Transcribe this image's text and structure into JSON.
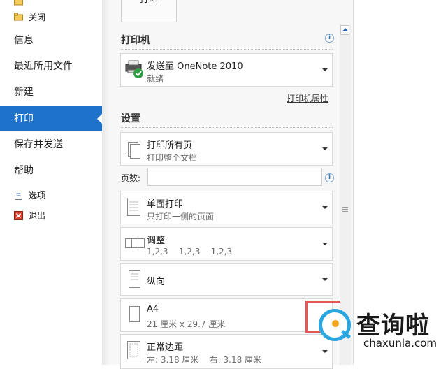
{
  "nav": {
    "close_label": "关闭",
    "items": [
      {
        "label": "信息",
        "active": false
      },
      {
        "label": "最近所用文件",
        "active": false
      },
      {
        "label": "新建",
        "active": false
      },
      {
        "label": "打印",
        "active": true
      },
      {
        "label": "保存并发送",
        "active": false
      },
      {
        "label": "帮助",
        "active": false
      }
    ],
    "options_label": "选项",
    "exit_label": "退出"
  },
  "print": {
    "button_label": "打印",
    "printer_section": "打印机",
    "printer_name": "发送至 OneNote 2010",
    "printer_status": "就绪",
    "printer_properties_link": "打印机属性",
    "settings_section": "设置",
    "settings": [
      {
        "title": "打印所有页",
        "subtitle": "打印整个文档",
        "icon": "pages-icon"
      },
      {
        "title": "单面打印",
        "subtitle": "只打印一侧的页面",
        "icon": "one-sided-icon"
      },
      {
        "title": "调整",
        "subtitle": "1,2,3    1,2,3    1,2,3",
        "icon": "collate-icon"
      },
      {
        "title": "纵向",
        "subtitle": "",
        "icon": "portrait-icon"
      },
      {
        "title": "A4",
        "subtitle": "21 厘米 x 29.7 厘米",
        "icon": "paper-size-icon"
      },
      {
        "title": "正常边距",
        "subtitle": "左: 3.18 厘米    右: 3.18 厘米",
        "icon": "margins-icon"
      }
    ],
    "pages_label": "页数:",
    "pages_value": ""
  },
  "watermark": {
    "title": "查询啦",
    "subtitle": "chaxunla.com"
  },
  "colors": {
    "accent": "#1e72c9",
    "panel_bg": "#f7f7f7"
  }
}
